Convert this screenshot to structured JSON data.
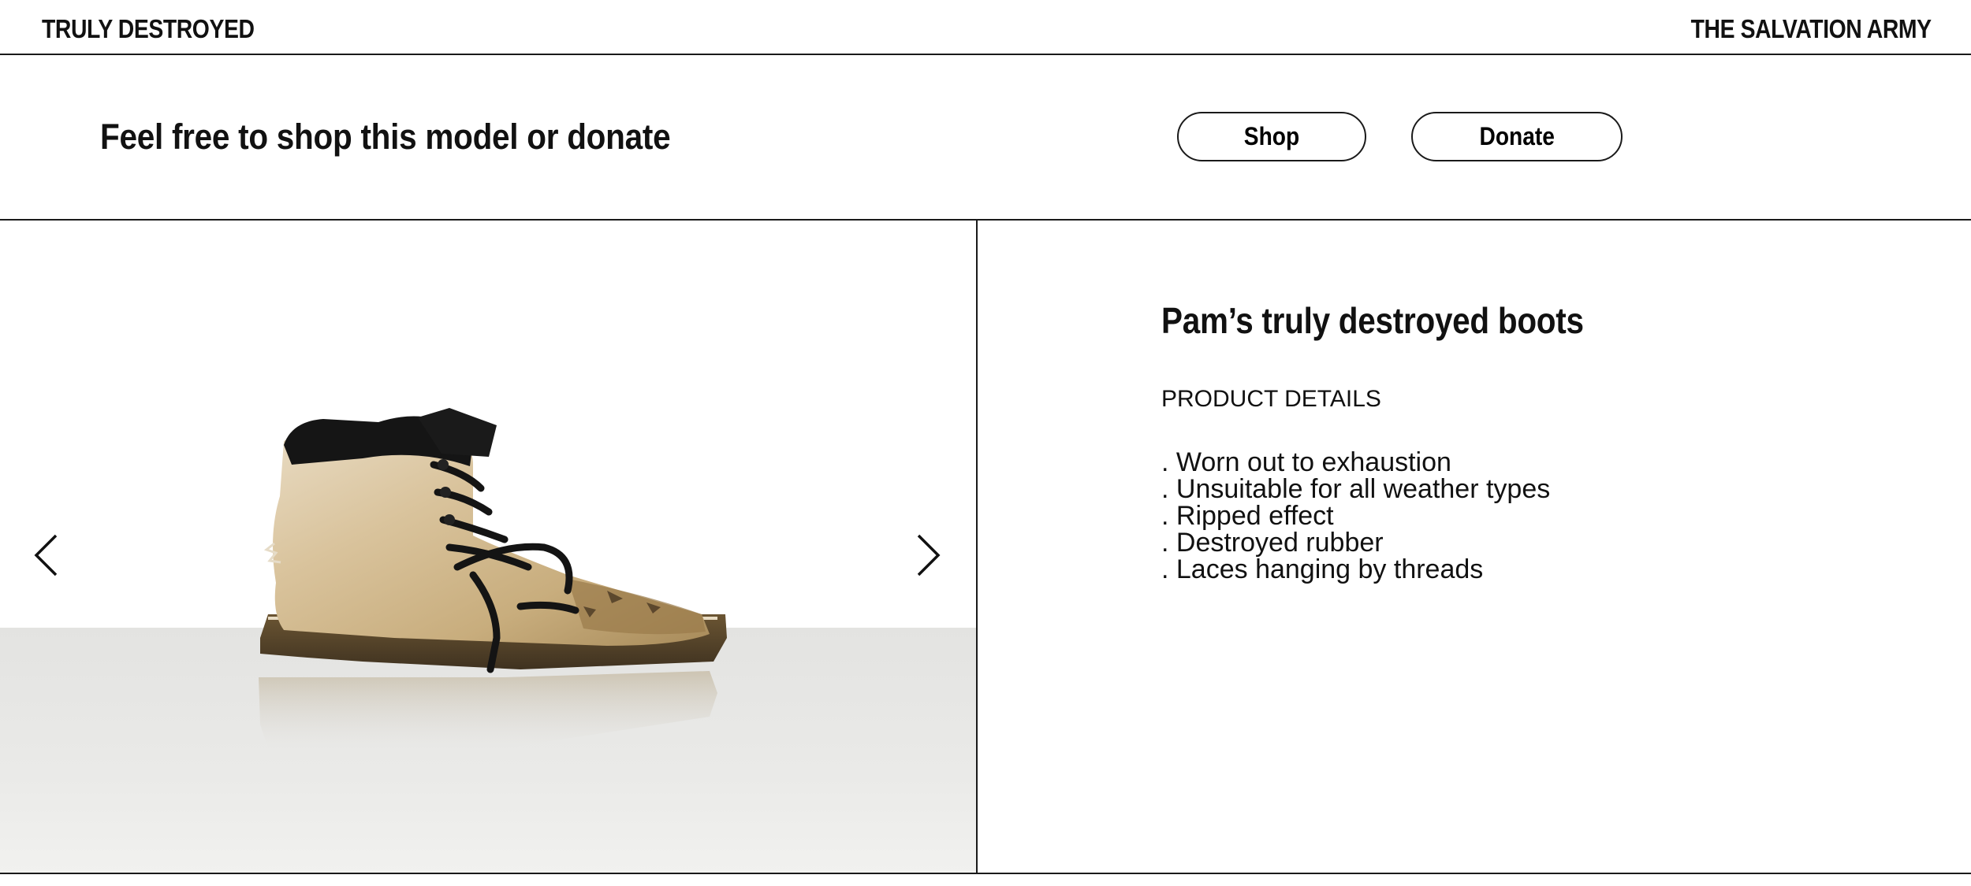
{
  "header": {
    "brand_left": "TRULY DESTROYED",
    "brand_right": "THE SALVATION ARMY"
  },
  "action_bar": {
    "headline": "Feel free to shop this model or donate",
    "shop_label": "Shop",
    "donate_label": "Donate"
  },
  "gallery": {
    "image_subject": "worn gold glitter lace-up boot",
    "prev_icon": "chevron-left-icon",
    "next_icon": "chevron-right-icon"
  },
  "product": {
    "title": "Pam’s truly destroyed boots",
    "details_label": "PRODUCT DETAILS",
    "features": [
      ". Worn out to exhaustion",
      ". Unsuitable for all weather types",
      ". Ripped effect",
      ". Destroyed rubber",
      ". Laces hanging by threads"
    ]
  },
  "colors": {
    "text": "#111111",
    "border": "#1a1a1a",
    "background": "#ffffff",
    "floor": "#e6e6e4"
  }
}
